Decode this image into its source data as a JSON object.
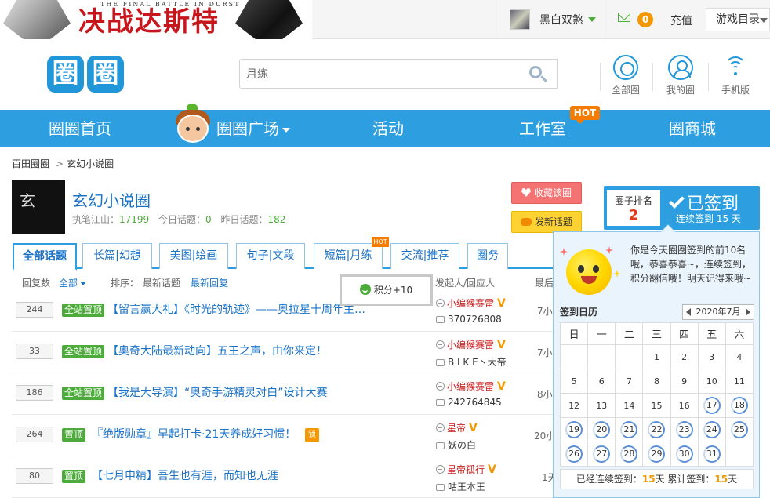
{
  "banner": {
    "subtitle": "THE FINAL BATTLE IN DURST",
    "title": "决战达斯特"
  },
  "user": {
    "name": "黑白双煞",
    "mail_count": "0",
    "recharge": "充值",
    "game_dir": "游戏目录"
  },
  "logo": {
    "chars": [
      "圈",
      "圈"
    ]
  },
  "search": {
    "value": "月练"
  },
  "nav_icons": [
    {
      "label": "全部圈",
      "icon": "circle-icon"
    },
    {
      "label": "我的圈",
      "icon": "user-icon"
    },
    {
      "label": "手机版",
      "icon": "wifi-icon"
    }
  ],
  "main_nav": {
    "home": "圈圈首页",
    "square": "圈圈广场",
    "activity": "活动",
    "studio": "工作室",
    "studio_badge": "HOT",
    "shop": "圈商城"
  },
  "breadcrumb": {
    "root": "百田圈圈",
    "current": "玄幻小说圈"
  },
  "circle": {
    "logo_text": "玄",
    "name": "玄幻小说圈",
    "stat1_label": "执笔江山：",
    "stat1_value": "17199",
    "stat2_label": "今日话题：",
    "stat2_value": "0",
    "stat3_label": "昨日话题：",
    "stat3_value": "182",
    "fav_button": "收藏该圈",
    "post_button": "发新话题"
  },
  "rank": {
    "label": "圈子排名",
    "value": "2",
    "signed": "已签到",
    "streak": "连续签到 15 天"
  },
  "tabs": [
    {
      "label": "全部话题"
    },
    {
      "label": "长篇|幻想"
    },
    {
      "label": "美图|绘画"
    },
    {
      "label": "句子|文段"
    },
    {
      "label": "短篇|月练"
    },
    {
      "label": "交流|推荐"
    },
    {
      "label": "圈务"
    }
  ],
  "tab_hot": "HOT",
  "filter": {
    "reply_count": "回复数",
    "all": "全部",
    "sort": "排序：",
    "latest_topic": "最新话题",
    "latest_reply": "最新回复",
    "author_col": "发起人/回应人",
    "last_col": "最后"
  },
  "points_popup": "积分+10",
  "topics": [
    {
      "count": "244",
      "tag": "全站置顶",
      "title": "【留言赢大礼】《时光的轨迹》——奥拉星十周年主…",
      "author": "小编猴赛雷",
      "v": "V",
      "replier": "370726808",
      "time": "7小"
    },
    {
      "count": "33",
      "tag": "全站置顶",
      "title": "【奥奇大陆最新动向】五王之声，由你来定！",
      "author": "小编猴赛雷",
      "v": "V",
      "replier": "B I K E丶大帝",
      "time": "7小"
    },
    {
      "count": "186",
      "tag": "全站置顶",
      "title": "【我是大导演】“奥奇手游精灵对白”设计大赛",
      "author": "小编猴赛雷",
      "v": "V",
      "replier": "242764845",
      "time": "8小"
    },
    {
      "count": "264",
      "tag": "置顶",
      "title": "『绝版勋章』早起打卡·21天养成好习惯！",
      "lock": "锁",
      "author": "星帝",
      "v": "V",
      "replier": "妖の白",
      "time": "20小"
    },
    {
      "count": "80",
      "tag": "置顶",
      "title": "【七月申精】吾生也有涯，而知也无涯",
      "author": "星帝孤行",
      "v": "V",
      "replier": "咕王本王",
      "time": "1天"
    }
  ],
  "sign_popup": {
    "congrats": "你是今天圈圈签到的前10名哦，恭喜恭喜~，连续签到，积分翻倍哦！明天记得来哦~",
    "calendar_title": "签到日历",
    "month": "2020年7月",
    "weekdays": [
      "日",
      "一",
      "二",
      "三",
      "四",
      "五",
      "六"
    ],
    "weeks": [
      [
        "",
        "",
        "",
        "1",
        "2",
        "3",
        "4"
      ],
      [
        "5",
        "6",
        "7",
        "8",
        "9",
        "10",
        "11"
      ],
      [
        "12",
        "13",
        "14",
        "15",
        "16",
        "17",
        "18"
      ],
      [
        "19",
        "20",
        "21",
        "22",
        "23",
        "24",
        "25"
      ],
      [
        "26",
        "27",
        "28",
        "29",
        "30",
        "31",
        ""
      ]
    ],
    "signed_days": [
      "17",
      "18",
      "19",
      "20",
      "21",
      "22",
      "23",
      "24",
      "25",
      "26",
      "27",
      "28",
      "29",
      "30",
      "31"
    ],
    "summary_streak_label": "已经连续签到：",
    "summary_streak": "15",
    "summary_unit": "天",
    "summary_total_label": "累计签到：",
    "summary_total": "15",
    "summary_unit2": "天"
  },
  "colors": {
    "brand_blue": "#2d9fe0",
    "accent_green": "#4cab3a",
    "hot_orange": "#f57c00",
    "title_red": "#c8161d"
  }
}
